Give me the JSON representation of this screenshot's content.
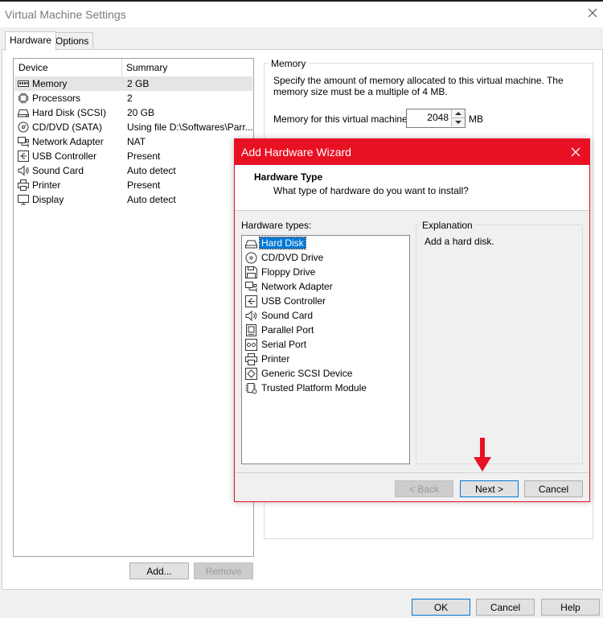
{
  "window": {
    "title": "Virtual Machine Settings"
  },
  "tabs": [
    {
      "label": "Hardware",
      "active": true
    },
    {
      "label": "Options",
      "active": false
    }
  ],
  "device_table": {
    "headers": [
      "Device",
      "Summary"
    ],
    "rows": [
      {
        "icon": "memory-icon",
        "device": "Memory",
        "summary": "2 GB",
        "selected": true
      },
      {
        "icon": "processor-icon",
        "device": "Processors",
        "summary": "2"
      },
      {
        "icon": "hard-disk-icon",
        "device": "Hard Disk (SCSI)",
        "summary": "20 GB"
      },
      {
        "icon": "cd-dvd-icon",
        "device": "CD/DVD (SATA)",
        "summary": "Using file D:\\Softwares\\Parr..."
      },
      {
        "icon": "network-adapter-icon",
        "device": "Network Adapter",
        "summary": "NAT"
      },
      {
        "icon": "usb-controller-icon",
        "device": "USB Controller",
        "summary": "Present"
      },
      {
        "icon": "sound-card-icon",
        "device": "Sound Card",
        "summary": "Auto detect"
      },
      {
        "icon": "printer-icon",
        "device": "Printer",
        "summary": "Present"
      },
      {
        "icon": "display-icon",
        "device": "Display",
        "summary": "Auto detect"
      }
    ]
  },
  "device_buttons": {
    "add": "Add...",
    "remove": "Remove"
  },
  "memory": {
    "group_label": "Memory",
    "description": "Specify the amount of memory allocated to this virtual machine. The memory size must be a multiple of 4 MB.",
    "field_label": "Memory for this virtual machine:",
    "value": "2048",
    "unit": "MB"
  },
  "footer_buttons": {
    "ok": "OK",
    "cancel": "Cancel",
    "help": "Help"
  },
  "wizard": {
    "title": "Add Hardware Wizard",
    "accent_color": "#e81123",
    "heading": "Hardware Type",
    "subheading": "What type of hardware do you want to install?",
    "list_label": "Hardware types:",
    "items": [
      {
        "icon": "hard-disk-icon",
        "label": "Hard Disk",
        "selected": true
      },
      {
        "icon": "cd-dvd-icon",
        "label": "CD/DVD Drive"
      },
      {
        "icon": "floppy-icon",
        "label": "Floppy Drive"
      },
      {
        "icon": "network-adapter-icon",
        "label": "Network Adapter"
      },
      {
        "icon": "usb-controller-icon",
        "label": "USB Controller"
      },
      {
        "icon": "sound-card-icon",
        "label": "Sound Card"
      },
      {
        "icon": "parallel-port-icon",
        "label": "Parallel Port"
      },
      {
        "icon": "serial-port-icon",
        "label": "Serial Port"
      },
      {
        "icon": "printer-icon",
        "label": "Printer"
      },
      {
        "icon": "generic-scsi-icon",
        "label": "Generic SCSI Device"
      },
      {
        "icon": "tpm-icon",
        "label": "Trusted Platform Module"
      }
    ],
    "explanation_label": "Explanation",
    "explanation_text": "Add a hard disk.",
    "buttons": {
      "back": "< Back",
      "next": "Next >",
      "cancel": "Cancel"
    }
  }
}
